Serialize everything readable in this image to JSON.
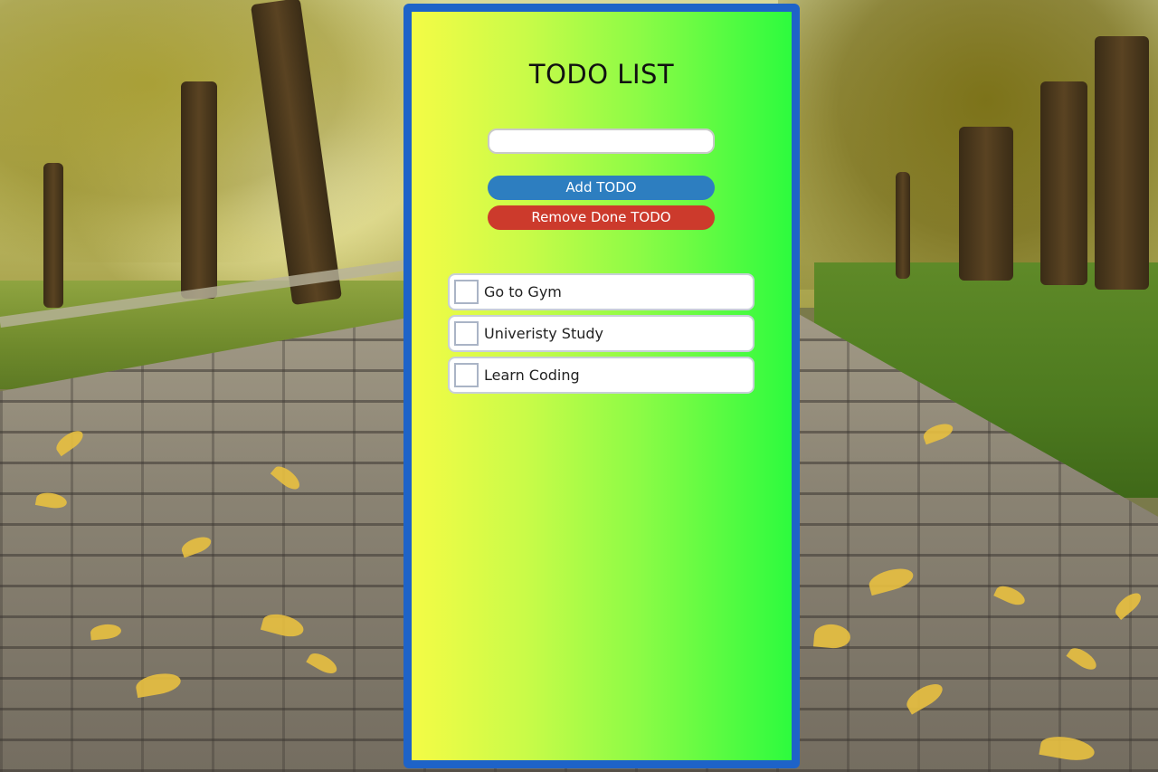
{
  "app": {
    "title": "TODO LIST"
  },
  "input": {
    "value": "",
    "placeholder": ""
  },
  "buttons": {
    "add_label": "Add TODO",
    "remove_label": "Remove Done TODO"
  },
  "todos": [
    {
      "text": "Go to Gym",
      "checked": false
    },
    {
      "text": "Univeristy Study",
      "checked": false
    },
    {
      "text": "Learn Coding",
      "checked": false
    }
  ],
  "colors": {
    "panel_border": "#1e63c8",
    "gradient_left": "#f4fb46",
    "gradient_right": "#2dfb3e",
    "add_button": "#2d7ec0",
    "remove_button": "#cc3a2c"
  },
  "background": {
    "scene": "autumn park path with fallen yellow leaves"
  }
}
